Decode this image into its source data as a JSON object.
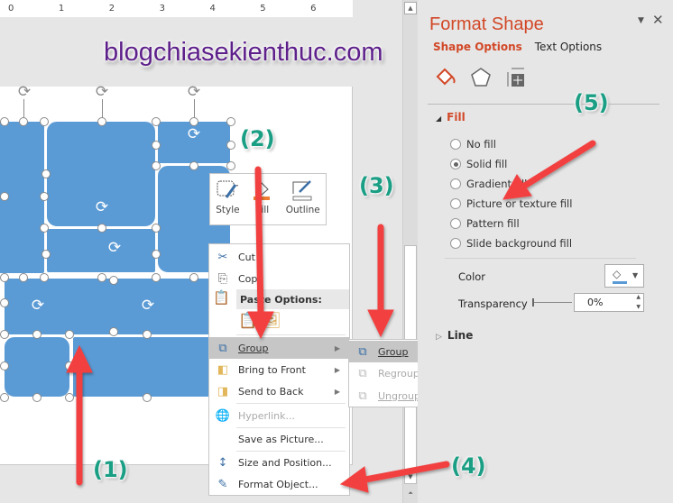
{
  "ruler": {
    "ticks": [
      "0",
      "1",
      "2",
      "3",
      "4",
      "5",
      "6"
    ]
  },
  "watermark": "blogchiasekienthuc.com",
  "annotations": [
    "(1)",
    "(2)",
    "(3)",
    "(4)",
    "(5)"
  ],
  "mini_toolbar": {
    "style": "Style",
    "fill": "Fill",
    "outline": "Outline"
  },
  "context_menu": {
    "cut": "Cut",
    "copy": "Copy",
    "paste_options": "Paste Options:",
    "group": "Group",
    "bring_to_front": "Bring to Front",
    "send_to_back": "Send to Back",
    "hyperlink": "Hyperlink...",
    "save_as_picture": "Save as Picture...",
    "size_and_position": "Size and Position...",
    "format_object": "Format Object..."
  },
  "group_submenu": {
    "group": "Group",
    "regroup": "Regroup",
    "ungroup": "Ungroup"
  },
  "format_pane": {
    "title": "Format Shape",
    "tabs": [
      "Shape Options",
      "Text Options"
    ],
    "active_tab": "Shape Options",
    "fill_section": "Fill",
    "fill_options": [
      "No fill",
      "Solid fill",
      "Gradient fill",
      "Picture or texture fill",
      "Pattern fill",
      "Slide background fill"
    ],
    "selected_fill": "Solid fill",
    "color_label": "Color",
    "color_value": "#5b9bd5",
    "transparency_label": "Transparency",
    "transparency_value": "0%",
    "line_section": "Line"
  }
}
